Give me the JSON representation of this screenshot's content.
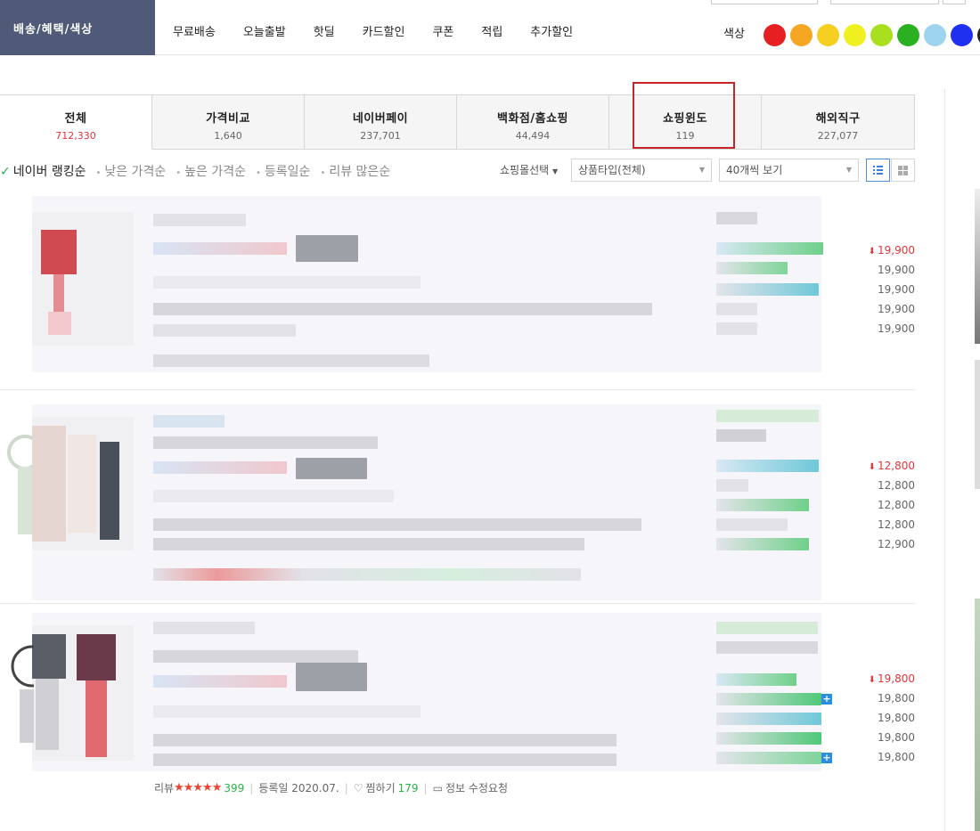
{
  "filter": {
    "label": "배송/혜택/색상",
    "options": [
      "무료배송",
      "오늘출발",
      "핫딜",
      "카드할인",
      "쿠폰",
      "적립",
      "추가할인"
    ],
    "color_label": "색상",
    "colors": [
      "#e62020",
      "#f5a623",
      "#f5d020",
      "#f0f020",
      "#a8e020",
      "#2ab020",
      "#9ed4ee",
      "#2030f0",
      "#222222"
    ]
  },
  "tabs": [
    {
      "name": "전체",
      "count": "712,330",
      "active": true
    },
    {
      "name": "가격비교",
      "count": "1,640"
    },
    {
      "name": "네이버페이",
      "count": "237,701"
    },
    {
      "name": "백화점/홈쇼핑",
      "count": "44,494"
    },
    {
      "name": "쇼핑윈도",
      "count": "119",
      "highlighted": true
    },
    {
      "name": "해외직구",
      "count": "227,077"
    }
  ],
  "sort": {
    "options": [
      "네이버 랭킹순",
      "낮은 가격순",
      "높은 가격순",
      "등록일순",
      "리뷰 많은순"
    ],
    "mall_select": "쇼핑몰선택",
    "type_select": "상품타입(전체)",
    "per_page": "40개씩 보기"
  },
  "products": [
    {
      "prices": [
        "19,900",
        "19,900",
        "19,900",
        "19,900",
        "19,900"
      ]
    },
    {
      "prices": [
        "12,800",
        "12,800",
        "12,800",
        "12,800",
        "12,900"
      ]
    },
    {
      "prices": [
        "19,800",
        "19,800",
        "19,800",
        "19,800",
        "19,800"
      ],
      "meta": {
        "review_label": "리뷰",
        "stars": "★★★★★",
        "review_count": "399",
        "reg_date": "등록일 2020.07.",
        "wish_label": "찜하기",
        "wish_count": "179",
        "report": "정보 수정요청"
      }
    }
  ],
  "icons": [
    "list-view-icon",
    "grid-view-icon",
    "check-icon",
    "down-arrow-icon",
    "plus-icon",
    "heart-icon",
    "report-icon"
  ]
}
